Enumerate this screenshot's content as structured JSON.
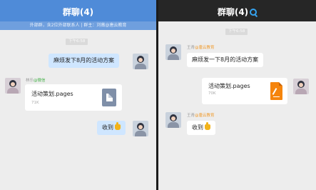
{
  "left": {
    "title": "群聊(4)",
    "subtitle": "外部群，含2位外部联系人 | 群主：刘薇@唐云教育",
    "time": "下午6:58",
    "msg1": "麻烦发下8月的活动方案",
    "sender": {
      "name": "林乐",
      "org": "@微信"
    },
    "file": {
      "name": "活动策划.pages",
      "size": "71K",
      "icon": "document-icon"
    },
    "msg2": "收到",
    "emoji": "thumbs-up-icon"
  },
  "right": {
    "title": "群聊(4)",
    "badge_icon": "q-search-icon",
    "time": "下午6:58",
    "sender1": {
      "name": "王青",
      "org": "@唐云教育"
    },
    "msg1": "麻烦发一下8月的活动方案",
    "file": {
      "name": "活动策划.pages",
      "size": "70K",
      "icon": "pages-icon"
    },
    "sender2": {
      "name": "王青",
      "org": "@唐云教育"
    },
    "msg2": "收到",
    "emoji": "thumbs-up-icon"
  },
  "colors": {
    "left_header": "#4f8bd8",
    "right_header": "#262626",
    "my_bubble": "#cfe6ff",
    "wechat_green": "#47b24a",
    "org_orange": "#f09a2a"
  }
}
